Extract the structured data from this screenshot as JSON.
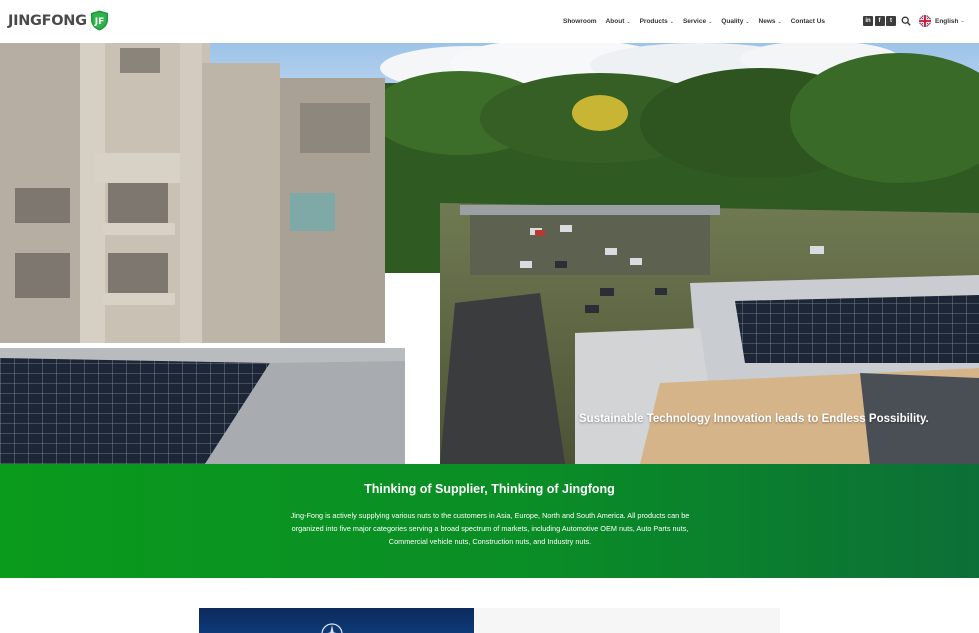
{
  "brand": {
    "name": "JINGFONG",
    "badge_letter": "JF",
    "accent": "#1e9b3a"
  },
  "nav": {
    "items": [
      {
        "label": "Showroom",
        "dropdown": false
      },
      {
        "label": "About",
        "dropdown": true
      },
      {
        "label": "Products",
        "dropdown": true
      },
      {
        "label": "Service",
        "dropdown": true
      },
      {
        "label": "Quality",
        "dropdown": true
      },
      {
        "label": "News",
        "dropdown": true
      },
      {
        "label": "Contact Us",
        "dropdown": false
      }
    ],
    "chevron": "⌄"
  },
  "socials": [
    {
      "icon": "linkedin-icon",
      "glyph": "in"
    },
    {
      "icon": "facebook-icon",
      "glyph": "f"
    },
    {
      "icon": "twitter-icon",
      "glyph": "t"
    }
  ],
  "language": {
    "label": "English",
    "icon": "uk-flag-icon"
  },
  "hero": {
    "caption": "Sustainable Technology Innovation leads to Endless Possibility."
  },
  "intro": {
    "title": "Thinking of Supplier, Thinking of Jingfong",
    "body": "Jing-Fong is actively supplying various nuts to the customers in Asia, Europe, North and South America. All products can be organized into five major categories serving a broad spectrum of markets, including Automotive OEM nuts, Auto Parts nuts, Commercial vehicle nuts, Construction nuts, and Industry nuts.",
    "band_colors": [
      "#0a9a1c",
      "#0c6f37"
    ]
  }
}
